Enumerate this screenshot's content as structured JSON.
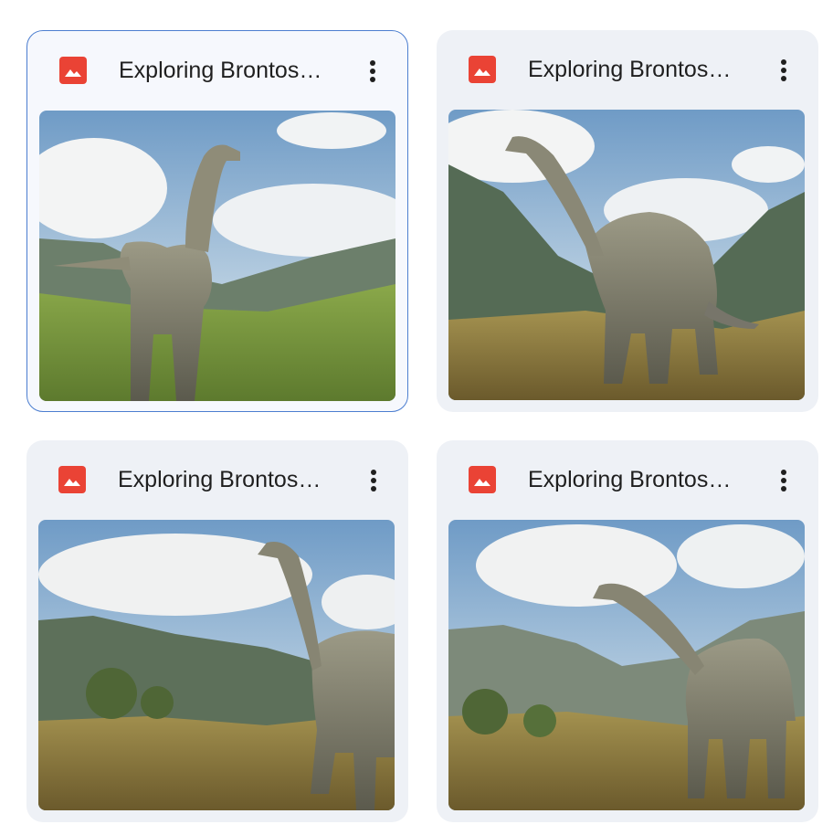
{
  "files": [
    {
      "title": "Exploring Brontos…",
      "icon": "image-file-icon",
      "selected": true,
      "menu_icon": "more-vert-icon"
    },
    {
      "title": "Exploring Brontos…",
      "icon": "image-file-icon",
      "selected": false,
      "menu_icon": "more-vert-icon"
    },
    {
      "title": "Exploring Brontos…",
      "icon": "image-file-icon",
      "selected": false,
      "menu_icon": "more-vert-icon"
    },
    {
      "title": "Exploring Brontos…",
      "icon": "image-file-icon",
      "selected": false,
      "menu_icon": "more-vert-icon"
    }
  ],
  "colors": {
    "card_bg": "#eef1f6",
    "selected_border": "#4c7ed0",
    "file_icon": "#ea4335",
    "title_text": "#1f1f1f"
  }
}
